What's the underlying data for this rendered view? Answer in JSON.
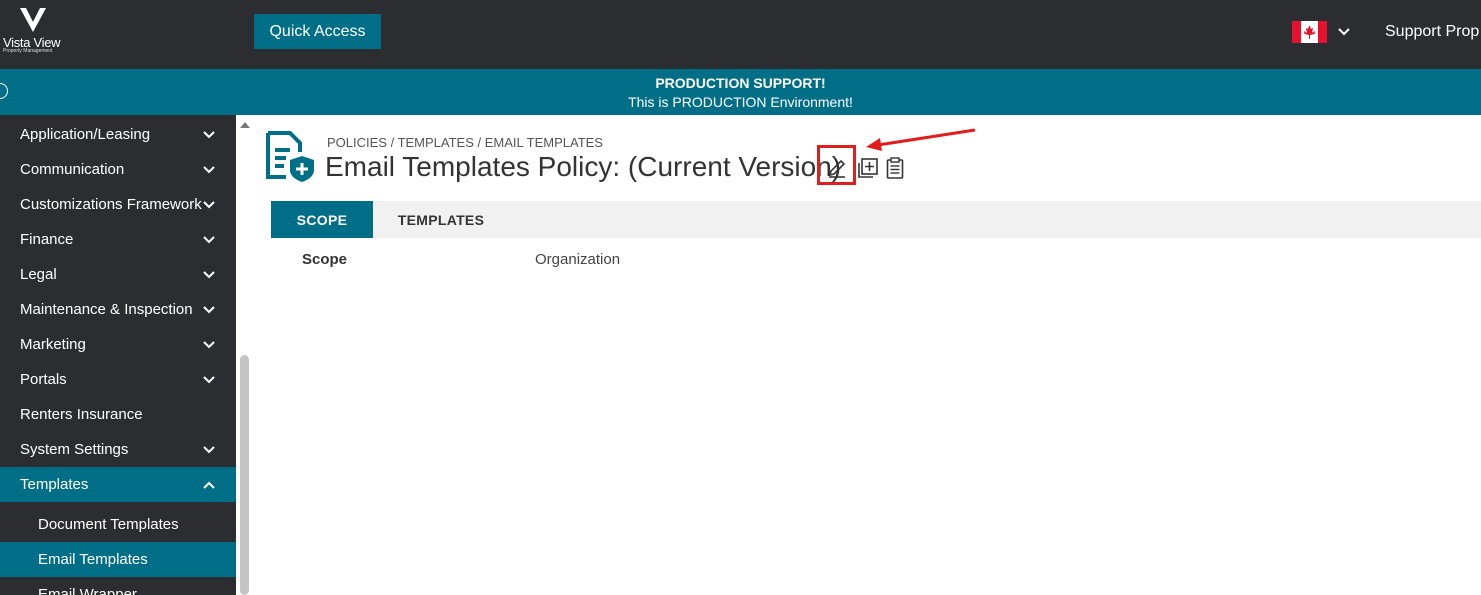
{
  "header": {
    "logo_text": "Vista View",
    "logo_subtext": "Property Management",
    "quick_access_label": "Quick Access",
    "country_flag": "canada-flag",
    "user_name": "Support Prop"
  },
  "banner": {
    "title": "PRODUCTION SUPPORT!",
    "subtitle": "This is PRODUCTION Environment!"
  },
  "sidebar": {
    "items": [
      {
        "label": "Application/Leasing",
        "chevron": "down"
      },
      {
        "label": "Communication",
        "chevron": "down"
      },
      {
        "label": "Customizations Framework",
        "chevron": "down"
      },
      {
        "label": "Finance",
        "chevron": "down"
      },
      {
        "label": "Legal",
        "chevron": "down"
      },
      {
        "label": "Maintenance & Inspection",
        "chevron": "down"
      },
      {
        "label": "Marketing",
        "chevron": "down"
      },
      {
        "label": "Portals",
        "chevron": "down"
      },
      {
        "label": "Renters Insurance",
        "chevron": ""
      },
      {
        "label": "System Settings",
        "chevron": "down"
      },
      {
        "label": "Templates",
        "chevron": "up",
        "active": true
      }
    ],
    "sub_items": [
      {
        "label": "Document Templates"
      },
      {
        "label": "Email Templates",
        "active": true
      },
      {
        "label": "Email Wrapper"
      }
    ]
  },
  "main": {
    "breadcrumb": "POLICIES / TEMPLATES / EMAIL TEMPLATES",
    "title": "Email Templates Policy: (Current Version)",
    "icons": [
      "policy-document-icon",
      "edit-icon",
      "copy-add-icon",
      "clipboard-icon"
    ],
    "tabs": [
      {
        "label": "SCOPE",
        "active": true
      },
      {
        "label": "TEMPLATES",
        "active": false
      }
    ],
    "fields": [
      {
        "label": "Scope",
        "value": "Organization"
      }
    ]
  },
  "colors": {
    "topbar": "#2b2d31",
    "accent": "#006e87",
    "annotation": "#e01e1e"
  }
}
